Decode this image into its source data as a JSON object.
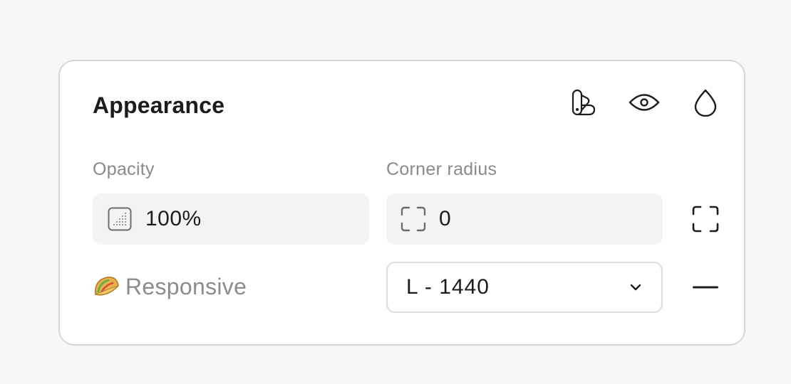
{
  "panel": {
    "title": "Appearance"
  },
  "header_icons": [
    {
      "name": "style-swatch-icon"
    },
    {
      "name": "eye-icon"
    },
    {
      "name": "droplet-icon"
    }
  ],
  "opacity": {
    "label": "Opacity",
    "value": "100%"
  },
  "corner_radius": {
    "label": "Corner radius",
    "value": "0"
  },
  "responsive": {
    "label": "Responsive",
    "selected": "L - 1440"
  },
  "colors": {
    "panel_bg": "#ffffff",
    "page_bg": "#f7f7f7",
    "field_bg": "#f3f3f3",
    "label_gray": "#8a8a8a",
    "text_dark": "#1c1c1c"
  }
}
